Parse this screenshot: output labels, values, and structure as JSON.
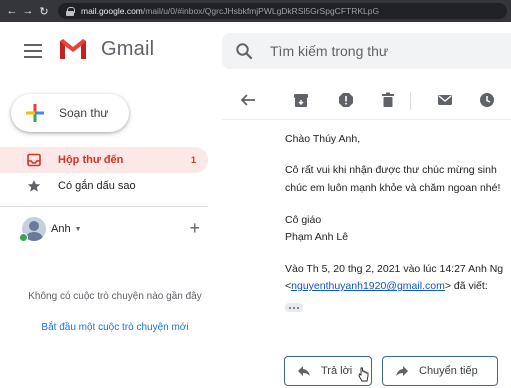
{
  "browser": {
    "url_host": "mail.google.com",
    "url_path": "/mail/u/0/#inbox/QgrcJHsbkfmjPWLgDkRSl5GrSpgCFTRKLpG"
  },
  "header": {
    "app_name": "Gmail",
    "search_placeholder": "Tìm kiếm trong thư"
  },
  "sidebar": {
    "compose_label": "Soạn thư",
    "items": [
      {
        "label": "Hộp thư đến",
        "count": "1",
        "icon": "inbox-icon",
        "active": true
      },
      {
        "label": "Có gắn dấu sao",
        "count": "",
        "icon": "star-icon",
        "active": false
      }
    ],
    "hangouts": {
      "name": "Anh",
      "no_conversations": "Không có cuộc trò chuyện nào gần đây",
      "start_link": "Bắt đầu một cuộc trò chuyện mới"
    }
  },
  "email": {
    "greeting": "Chào Thúy Anh,",
    "line1": "Cô rất vui khi nhận được thư chúc mừng sinh",
    "line2": "chúc em luôn mạnh khỏe và chăm ngoan nhé!",
    "signoff": "Cô giáo",
    "signature": "Phạm Anh Lê",
    "quote_header": "Vào Th 5, 20 thg 2, 2021 vào lúc 14:27 Anh Ng",
    "quote_email_open": "<",
    "quote_email": "nguyenthuyanh1920@gmail.com",
    "quote_email_close": "> đã viết:"
  },
  "actions": {
    "reply_label": "Trả lời",
    "forward_label": "Chuyển tiếp"
  },
  "colors": {
    "accent_red": "#d93025",
    "active_bg": "#fce8e6",
    "link_blue": "#1155cc",
    "button_border": "#3c6b8f"
  }
}
